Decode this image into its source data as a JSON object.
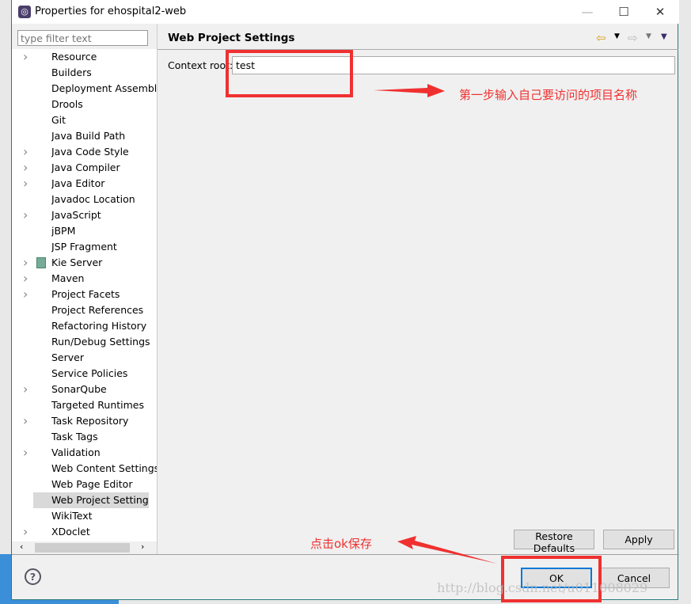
{
  "window": {
    "title": "Properties for ehospital2-web",
    "minimize": "—",
    "maximize": "☐",
    "close": "✕"
  },
  "filter": {
    "placeholder": "type filter text"
  },
  "tree": [
    {
      "label": "Resource",
      "expandable": true
    },
    {
      "label": "Builders",
      "expandable": false
    },
    {
      "label": "Deployment Assembly",
      "expandable": false
    },
    {
      "label": "Drools",
      "expandable": false
    },
    {
      "label": "Git",
      "expandable": false
    },
    {
      "label": "Java Build Path",
      "expandable": false
    },
    {
      "label": "Java Code Style",
      "expandable": true
    },
    {
      "label": "Java Compiler",
      "expandable": true
    },
    {
      "label": "Java Editor",
      "expandable": true
    },
    {
      "label": "Javadoc Location",
      "expandable": false
    },
    {
      "label": "JavaScript",
      "expandable": true
    },
    {
      "label": "jBPM",
      "expandable": false
    },
    {
      "label": "JSP Fragment",
      "expandable": false
    },
    {
      "label": "Kie Server",
      "expandable": true
    },
    {
      "label": "Maven",
      "expandable": true
    },
    {
      "label": "Project Facets",
      "expandable": true
    },
    {
      "label": "Project References",
      "expandable": false
    },
    {
      "label": "Refactoring History",
      "expandable": false
    },
    {
      "label": "Run/Debug Settings",
      "expandable": false
    },
    {
      "label": "Server",
      "expandable": false
    },
    {
      "label": "Service Policies",
      "expandable": false
    },
    {
      "label": "SonarQube",
      "expandable": true
    },
    {
      "label": "Targeted Runtimes",
      "expandable": false
    },
    {
      "label": "Task Repository",
      "expandable": true
    },
    {
      "label": "Task Tags",
      "expandable": false
    },
    {
      "label": "Validation",
      "expandable": true
    },
    {
      "label": "Web Content Settings",
      "expandable": false
    },
    {
      "label": "Web Page Editor",
      "expandable": false
    },
    {
      "label": "Web Project Settings",
      "expandable": false,
      "selected": true
    },
    {
      "label": "WikiText",
      "expandable": false
    },
    {
      "label": "XDoclet",
      "expandable": true
    }
  ],
  "page": {
    "title": "Web Project Settings",
    "context_root_label": "Context root:",
    "context_root_value": "test"
  },
  "buttons": {
    "restore": "Restore Defaults",
    "apply": "Apply",
    "ok": "OK",
    "cancel": "Cancel",
    "help": "?"
  },
  "annotations": {
    "step1": "第一步输入自己要访问的项目名称",
    "step2": "点击ok保存",
    "color": "#f03030"
  },
  "watermark": "http://blog.csdn.net/u011008029"
}
